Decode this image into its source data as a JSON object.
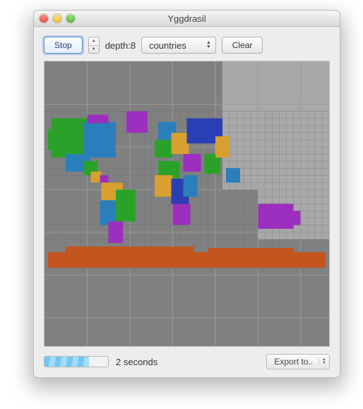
{
  "window": {
    "title": "Yggdrasil"
  },
  "toolbar": {
    "stop_label": "Stop",
    "depth_label": "depth:8",
    "layer_selected": "countries",
    "clear_label": "Clear"
  },
  "status": {
    "time_label": "2 seconds",
    "export_label": "Export to..",
    "progress_fraction": 0.7
  },
  "map": {
    "background": "#808080",
    "light_region": "#a8a8a8",
    "grid_major": "#9a9a9a",
    "regions": {
      "north_america_w": "#2aa22a",
      "north_america_e": "#2a7fba",
      "mexico": "#2aa22a",
      "central_america": "#d8a030",
      "caribbean": "#9c2fbf",
      "south_america_n": "#d8a030",
      "south_america_w": "#2a7fba",
      "south_america_e": "#2aa22a",
      "south_america_s": "#9c2fbf",
      "greenland": "#9c2fbf",
      "europe_w": "#2aa22a",
      "europe_e": "#d8a030",
      "scandinavia": "#2a7fba",
      "russia": "#2a3fb5",
      "middle_east": "#9c2fbf",
      "africa_n": "#2aa22a",
      "africa_w": "#d8a030",
      "africa_c": "#2a3fb5",
      "africa_e": "#2a7fba",
      "africa_s": "#9c2fbf",
      "india": "#2aa22a",
      "china": "#d8a030",
      "sea": "#2a7fba",
      "australia": "#9c2fbf",
      "antarctica": "#c4551f"
    }
  }
}
